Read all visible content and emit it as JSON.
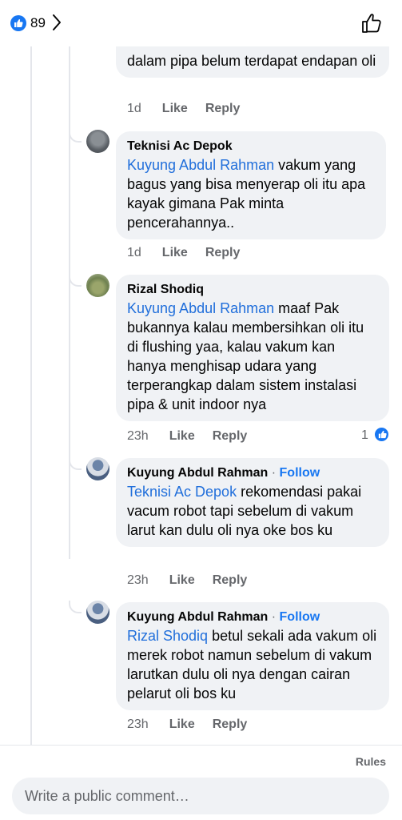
{
  "header": {
    "reaction_count": "89"
  },
  "partial_comment": {
    "text": "dalam pipa belum terdapat endapan oli",
    "time": "1d",
    "like": "Like",
    "reply": "Reply"
  },
  "comments": [
    {
      "author": "Teknisi Ac Depok",
      "mention": "Kuyung Abdul Rahman",
      "text": " vakum yang bagus yang bisa menyerap oli itu apa kayak gimana Pak minta pencerahannya..",
      "time": "1d",
      "like": "Like",
      "reply": "Reply"
    },
    {
      "author": "Rizal Shodiq",
      "mention": "Kuyung Abdul Rahman",
      "text": " maaf Pak bukannya kalau membersihkan oli itu di flushing yaa, kalau vakum kan hanya menghisap udara yang terperangkap dalam sistem instalasi pipa & unit indoor nya",
      "time": "23h",
      "like": "Like",
      "reply": "Reply",
      "reactions": "1"
    },
    {
      "author": "Kuyung Abdul Rahman",
      "follow": "Follow",
      "separator": " · ",
      "mention": "Teknisi Ac Depok",
      "text": "  rekomendasi pakai vacum robot tapi sebelum di vakum larut kan dulu oli nya oke bos ku",
      "time": "23h",
      "like": "Like",
      "reply": "Reply"
    },
    {
      "author": "Kuyung Abdul Rahman",
      "follow": "Follow",
      "separator": " · ",
      "mention": "Rizal Shodiq",
      "text": "  betul sekali ada vakum oli merek robot namun sebelum di vakum larutkan dulu oli nya dengan cairan pelarut oli  bos ku",
      "time": "23h",
      "like": "Like",
      "reply": "Reply"
    }
  ],
  "footer": {
    "rules": "Rules",
    "placeholder": "Write a public comment…"
  },
  "colors": {
    "accent": "#1877f2",
    "mention": "#216fdb",
    "bubble": "#f0f2f5",
    "muted": "#65676b"
  },
  "icons": [
    "like-badge-icon",
    "chevron-right-icon",
    "thumbs-up-outline-icon"
  ]
}
